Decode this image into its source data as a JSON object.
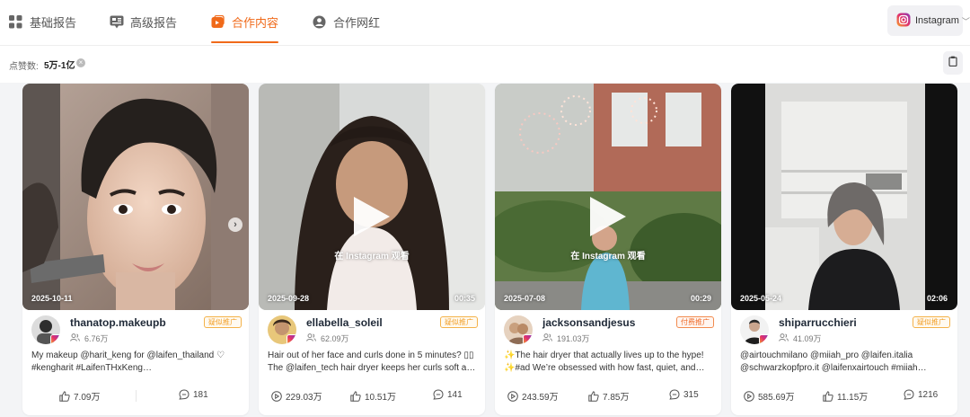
{
  "nav": {
    "tabs": [
      {
        "label": "基础报告",
        "icon": "grid-icon"
      },
      {
        "label": "高级报告",
        "icon": "report-icon"
      },
      {
        "label": "合作内容",
        "icon": "content-icon",
        "active": true
      },
      {
        "label": "合作网红",
        "icon": "user-icon"
      }
    ],
    "platform": {
      "label": "Instagram",
      "icon": "instagram-icon"
    }
  },
  "filter": {
    "label": "点赞数:",
    "value": "5万-1亿"
  },
  "colors": {
    "accent": "#f06a1a",
    "tag": "#f2a02a"
  },
  "watch_on_instagram": "在 Instagram 观看",
  "cards": [
    {
      "date": "2025-10-11",
      "duration": "",
      "handle": "thanatop.makeupb",
      "followers": "6.76万",
      "tag": "疑似推广",
      "caption": [
        "My makeup @harit_keng for @laifen_thailand ♡",
        "#kengharit #LaifenTHxKeng…"
      ],
      "likes": "7.09万",
      "comments": "181",
      "views": ""
    },
    {
      "date": "2025-09-28",
      "duration": "00:35",
      "handle": "ellabella_soleil",
      "followers": "62.09万",
      "tag": "疑似推广",
      "caption": [
        "Hair out of her face and curls done in 5 minutes? ▯▯",
        "The @laifen_tech hair dryer keeps her curls soft an…"
      ],
      "views": "229.03万",
      "likes": "10.51万",
      "comments": "141"
    },
    {
      "date": "2025-07-08",
      "duration": "00:29",
      "handle": "jacksonsandjesus",
      "followers": "191.03万",
      "tag": "付费推广",
      "caption": [
        "✨The hair dryer that actually lives up to the hype!",
        "✨#ad We’re obsessed with how fast, quiet, and…"
      ],
      "views": "243.59万",
      "likes": "7.85万",
      "comments": "315"
    },
    {
      "date": "2025-05-24",
      "duration": "02:06",
      "handle": "shiparrucchieri",
      "followers": "41.09万",
      "tag": "疑似推广",
      "caption": [
        "@airtouchmilano @miiah_pro @laifen.italia",
        "@schwarzkopfpro.it @laifenxairtouch #miiah…"
      ],
      "views": "585.69万",
      "likes": "11.15万",
      "comments": "1216"
    }
  ]
}
